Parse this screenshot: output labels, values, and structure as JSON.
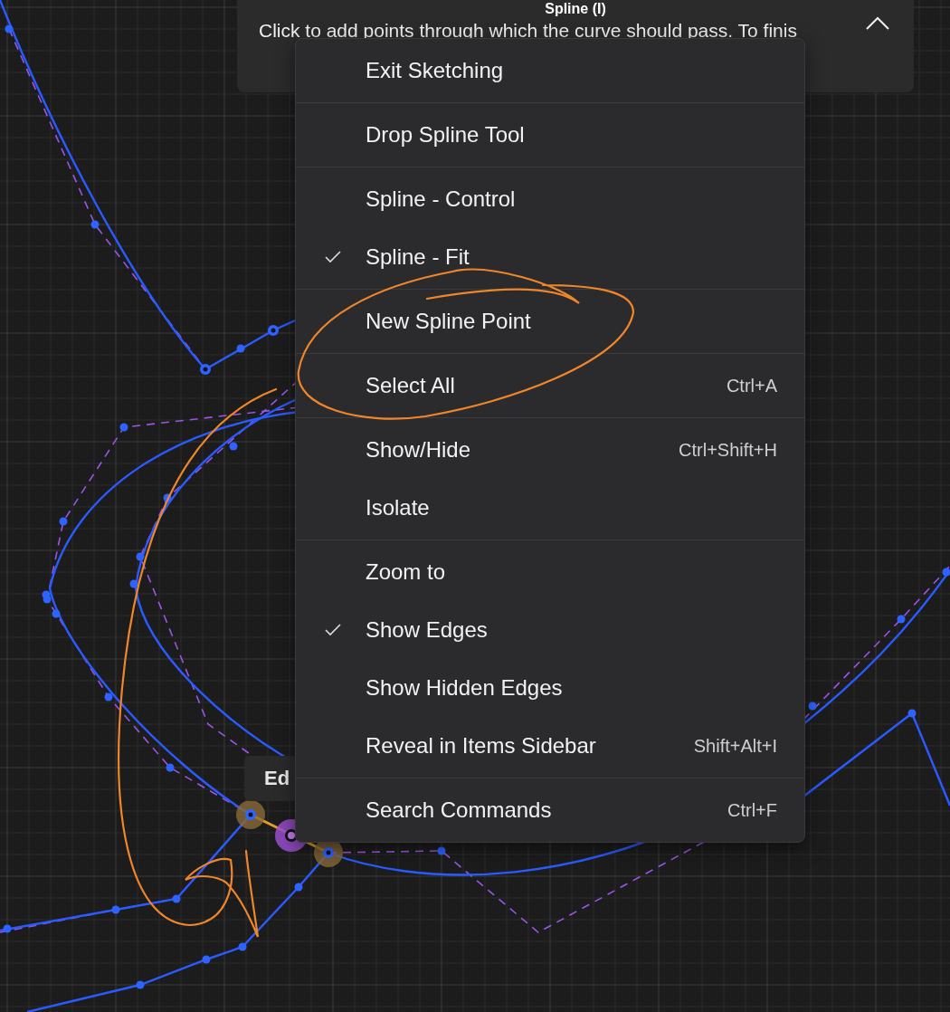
{
  "hint_panel": {
    "title": "Spline (I)",
    "text": "Click to add points through which the curve should pass. To finis"
  },
  "tooltip": {
    "text": "Ed"
  },
  "context_menu": {
    "groups": [
      {
        "items": [
          {
            "label": "Exit Sketching",
            "checked": false
          }
        ]
      },
      {
        "items": [
          {
            "label": "Drop Spline Tool",
            "checked": false
          }
        ]
      },
      {
        "items": [
          {
            "label": "Spline - Control",
            "checked": false
          },
          {
            "label": "Spline - Fit",
            "checked": true
          }
        ]
      },
      {
        "items": [
          {
            "label": "New Spline Point",
            "checked": false
          }
        ]
      },
      {
        "items": [
          {
            "label": "Select All",
            "checked": false,
            "shortcut": "Ctrl+A"
          }
        ]
      },
      {
        "items": [
          {
            "label": "Show/Hide",
            "checked": false,
            "shortcut": "Ctrl+Shift+H"
          },
          {
            "label": "Isolate",
            "checked": false
          }
        ]
      },
      {
        "items": [
          {
            "label": "Zoom to",
            "checked": false
          },
          {
            "label": "Show Edges",
            "checked": true
          },
          {
            "label": "Show Hidden Edges",
            "checked": false
          },
          {
            "label": "Reveal in Items Sidebar",
            "checked": false,
            "shortcut": "Shift+Alt+I"
          }
        ]
      },
      {
        "items": [
          {
            "label": "Search Commands",
            "checked": false,
            "shortcut": "Ctrl+F"
          }
        ]
      }
    ]
  }
}
